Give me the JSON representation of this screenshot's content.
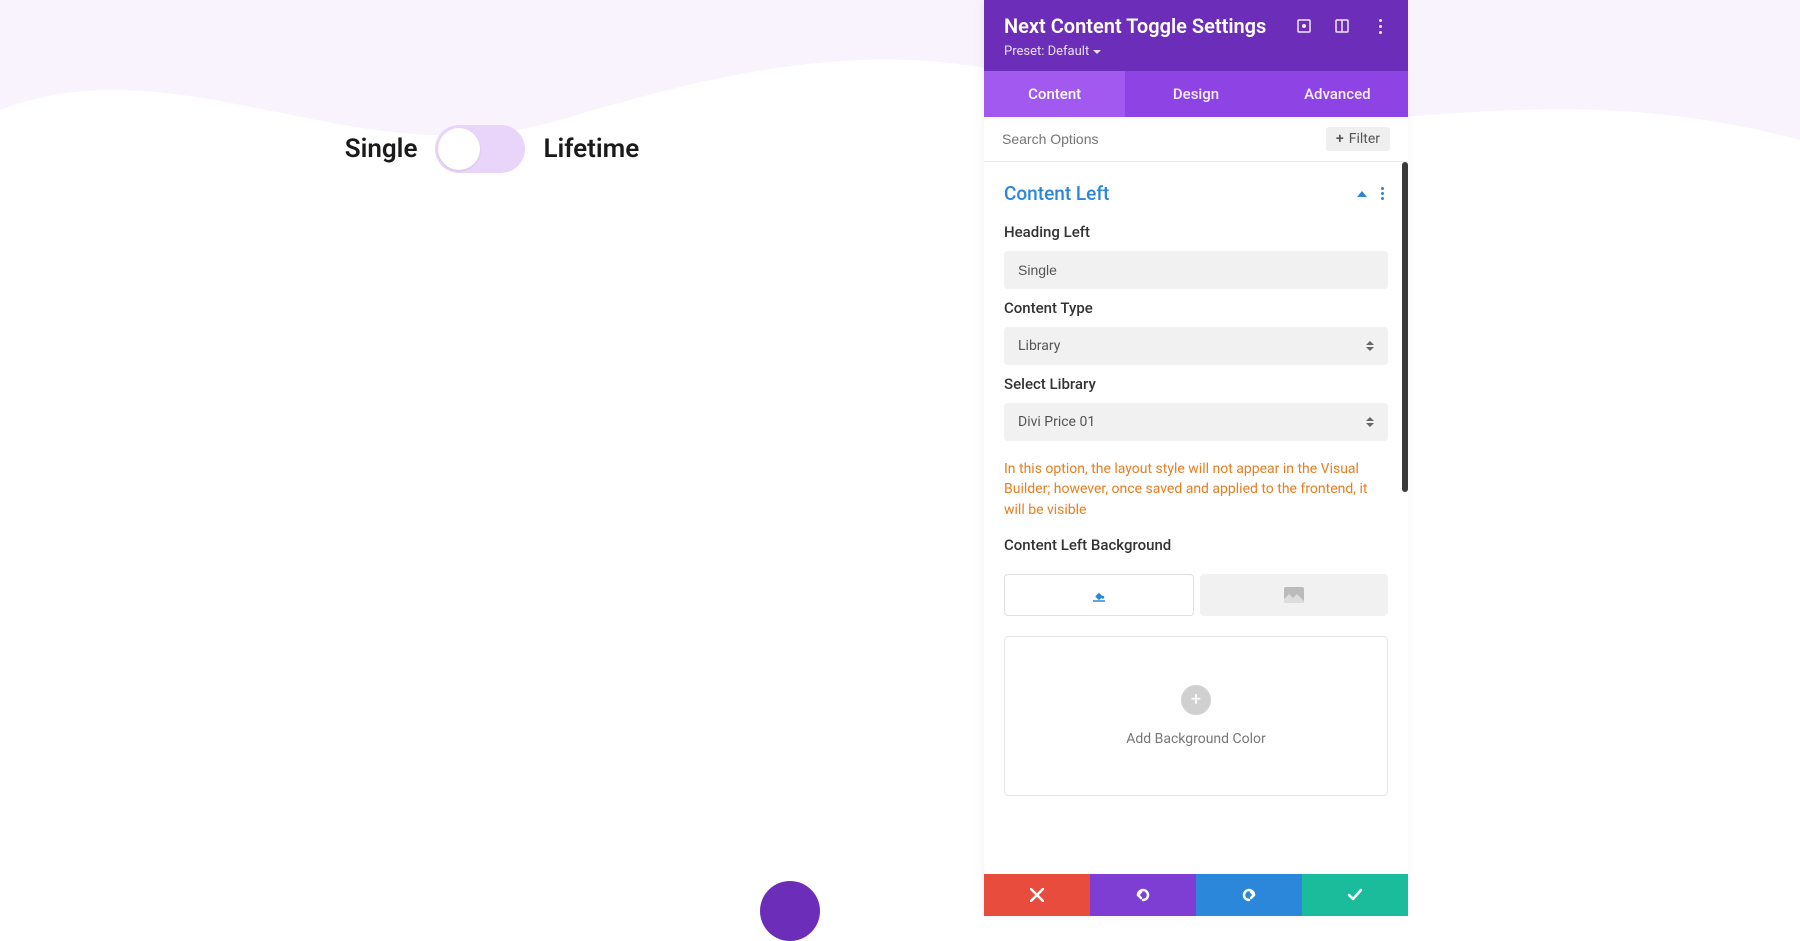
{
  "preview": {
    "toggle_left_label": "Single",
    "toggle_right_label": "Lifetime"
  },
  "panel": {
    "title": "Next Content Toggle Settings",
    "preset_label": "Preset: Default",
    "tabs": {
      "content": "Content",
      "design": "Design",
      "advanced": "Advanced",
      "active": "content"
    },
    "search": {
      "placeholder": "Search Options",
      "filter_label": "Filter"
    },
    "section": {
      "title": "Content Left",
      "heading_left_label": "Heading Left",
      "heading_left_value": "Single",
      "content_type_label": "Content Type",
      "content_type_value": "Library",
      "select_library_label": "Select Library",
      "select_library_value": "Divi Price 01",
      "info_text": "In this option, the layout style will not appear in the Visual Builder; however, once saved and applied to the frontend, it will be visible",
      "content_left_bg_label": "Content Left Background",
      "add_bg_label": "Add Background Color"
    }
  }
}
